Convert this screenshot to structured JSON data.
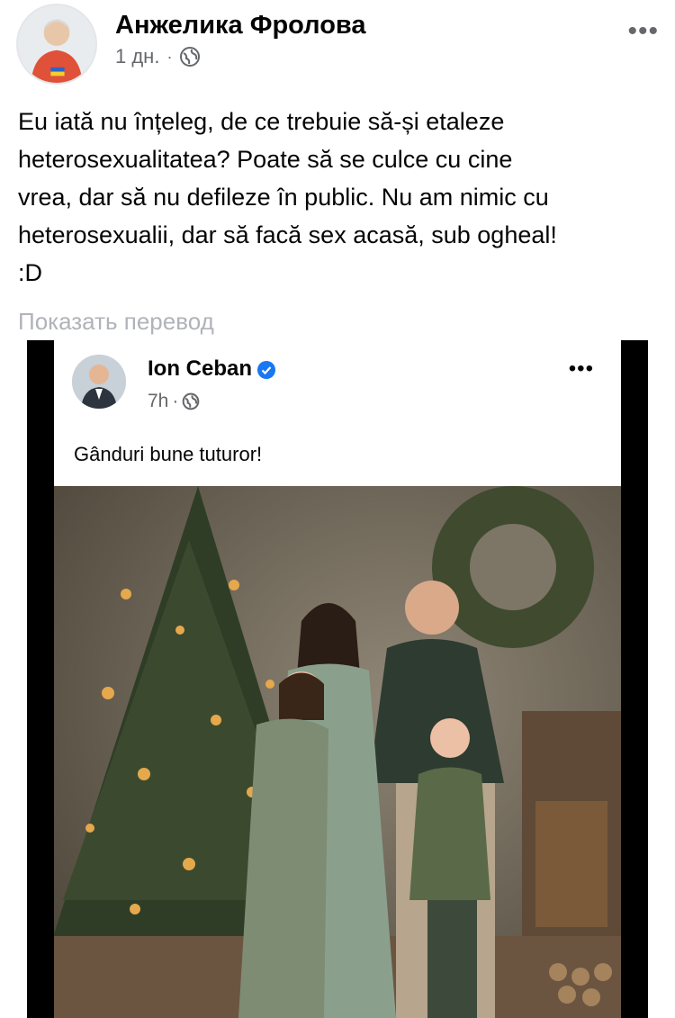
{
  "post": {
    "author": "Анжелика Фролова",
    "time": "1 дн.",
    "separator": "·",
    "more_label": "•••",
    "text": "Eu iată nu înțeleg, de ce trebuie să-și etaleze\nheterosexualitatea? Poate să se culce cu cine\nvrea, dar să nu defileze în public. Nu am nimic cu\nheterosexualii, dar să facă sex acasă, sub ogheal!\n:D",
    "translate_label": "Показать перевод"
  },
  "shared": {
    "author": "Ion Ceban",
    "time": "7h",
    "separator": "·",
    "more_label": "•••",
    "text": "Gânduri bune tuturor!"
  },
  "icons": {
    "privacy": "globe-icon",
    "verified": "verified-badge-icon",
    "more": "more-options-icon"
  },
  "colors": {
    "text": "#050505",
    "secondary": "#65676b",
    "translate": "#b0b3b8",
    "verified": "#1877f2"
  }
}
